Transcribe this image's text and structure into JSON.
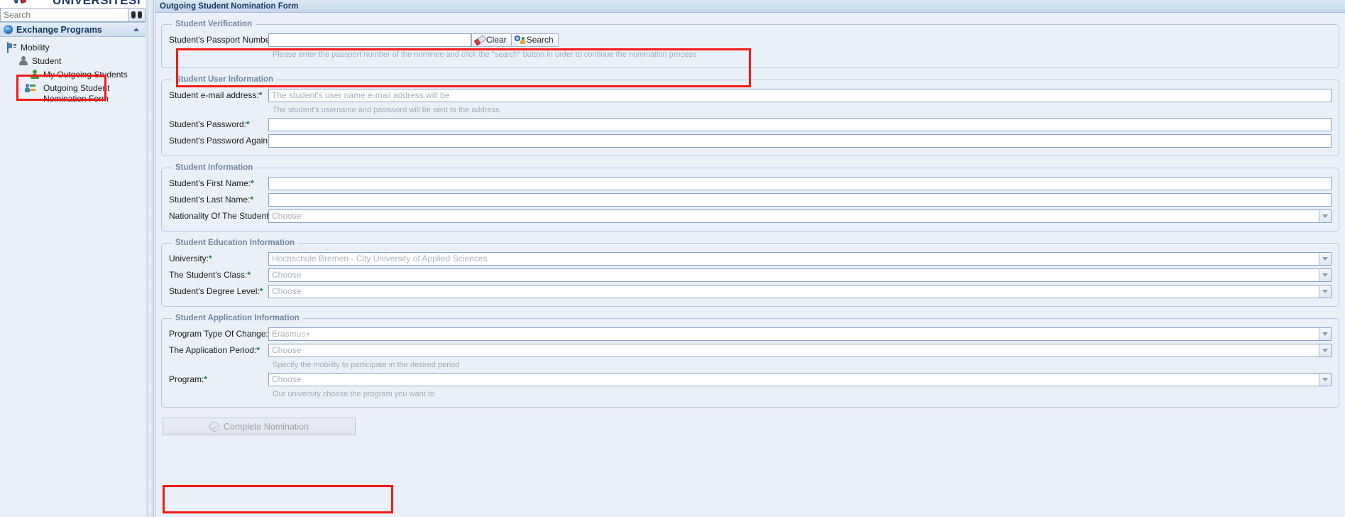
{
  "brand": {
    "logo_word": "ÜNIVERSITESI",
    "logo_mark": "\\/\\/"
  },
  "sidebar": {
    "search": {
      "placeholder": "Search",
      "value": "",
      "icon": "binoculars-icon"
    },
    "module": {
      "title": "Exchange Programs",
      "icon": "globe-icon",
      "collapse_icon": "chevron-up-icon"
    },
    "tree": [
      {
        "label": "Mobility",
        "level": 1,
        "icon": "id-card-icon"
      },
      {
        "label": "Student",
        "level": 2,
        "icon": "person-gray-icon"
      },
      {
        "label": "My Outgoing Students",
        "level": 3,
        "icon": "person-green-icon"
      },
      {
        "label": "Outgoing Student Nomination Form",
        "level": 4,
        "icon": "exchange-person-icon",
        "highlighted": true
      }
    ]
  },
  "tab": {
    "label": "Outgoing Student Nomination Form"
  },
  "sections": {
    "verification": {
      "legend": "Student Verification",
      "passport_label": "Student's Passport Number:",
      "passport_value": "",
      "clear_label": "Clear",
      "clear_icon": "eraser-icon",
      "search_label": "Search",
      "search_icon": "search-user-icon",
      "hint": "Please enter the passport number of the nominee and click the \"search\" button in order to continue the nomination process",
      "highlighted": true
    },
    "user_info": {
      "legend": "Student User Information",
      "email_label": "Student e-mail address:",
      "email_placeholder": "The student's user name e-mail address will be",
      "email_hint": "The student's username and password will be sent to the address.",
      "password_label": "Student's Password:",
      "password_value": "",
      "password_again_label": "Student's Password Again:",
      "password_again_value": ""
    },
    "student_info": {
      "legend": "Student Information",
      "first_name_label": "Student's First Name:",
      "first_name_value": "",
      "last_name_label": "Student's Last Name:",
      "last_name_value": "",
      "nationality_label": "Nationality Of The Student:",
      "nationality_value": "Choose"
    },
    "education_info": {
      "legend": "Student Education Information",
      "university_label": "University:",
      "university_value": "Hochschule Bremen - City University of Applied Sciences",
      "class_label": "The Student's Class:",
      "class_value": "Choose",
      "degree_label": "Student's Degree Level:",
      "degree_value": "Choose"
    },
    "application_info": {
      "legend": "Student Application Information",
      "program_type_label": "Program Type Of Change:",
      "program_type_value": "Erasmus+",
      "period_label": "The Application Period:",
      "period_value": "Choose",
      "period_hint": "Specify the mobility to participate in the desired period",
      "program_label": "Program:",
      "program_value": "Choose",
      "program_hint": "Our university choose the program you want to"
    }
  },
  "submit": {
    "label": "Complete Nomination",
    "icon": "check-circle-icon",
    "highlighted": true
  },
  "colors": {
    "highlight": "#f41a16",
    "required": "#1f7a33",
    "legend": "#7186a3",
    "tab_text": "#1a3b66",
    "page_bg": "#eaf0f8"
  }
}
